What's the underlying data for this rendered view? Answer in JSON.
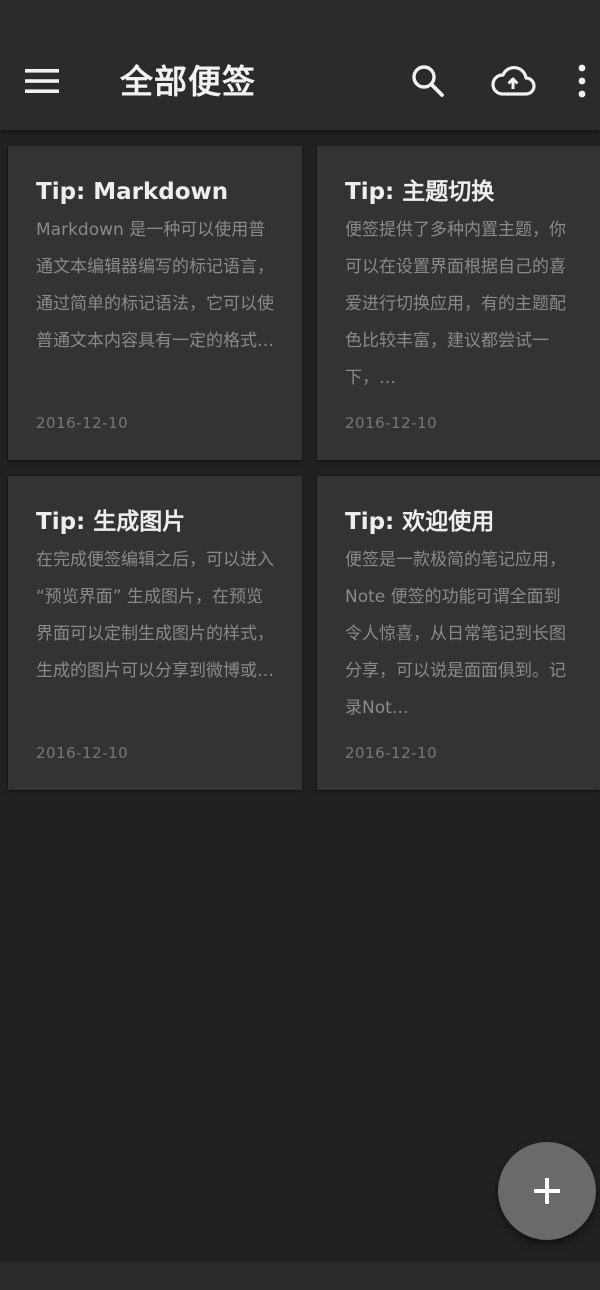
{
  "app_bar": {
    "title": "全部便签",
    "menu_icon": "hamburger-menu-icon",
    "search_icon": "search-icon",
    "cloud_icon": "cloud-sync-icon",
    "more_icon": "more-vert-icon"
  },
  "notes": [
    {
      "title": "Tip: Markdown",
      "body": "Markdown 是一种可以使用普通文本编辑器编写的标记语言，通过简单的标记语法，它可以使普通文本内容具有一定的格式…",
      "date": "2016-12-10"
    },
    {
      "title": "Tip: 主题切换",
      "body": "便签提供了多种内置主题，你可以在设置界面根据自己的喜爱进行切换应用，有的主题配色比较丰富，建议都尝试一下，…",
      "date": "2016-12-10"
    },
    {
      "title": "Tip: 生成图片",
      "body": "在完成便签编辑之后，可以进入 “预览界面” 生成图片，在预览界面可以定制生成图片的样式，生成的图片可以分享到微博或…",
      "date": "2016-12-10"
    },
    {
      "title": "Tip: 欢迎使用",
      "body": "便签是一款极简的笔记应用，Note 便签的功能可谓全面到令人惊喜，从日常笔记到长图分享，可以说是面面俱到。记录Not…",
      "date": "2016-12-10"
    }
  ],
  "fab": {
    "icon": "plus-icon"
  },
  "colors": {
    "background": "#202123",
    "app_bar": "#2a2b2d",
    "card": "#333335",
    "fab": "#6a6a6c"
  }
}
